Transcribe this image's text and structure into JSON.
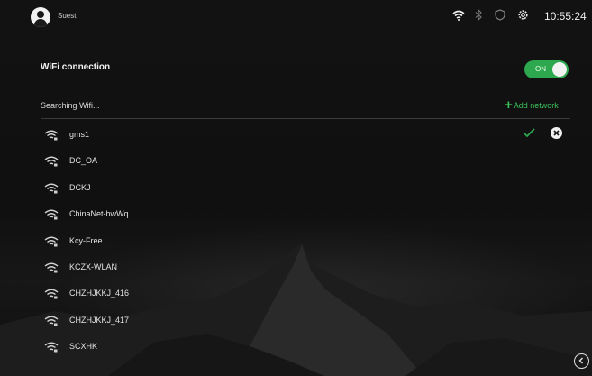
{
  "status_bar": {
    "user_name": "Suest",
    "time": "10:55:24",
    "icons": [
      "wifi-icon",
      "bluetooth-icon",
      "shield-icon",
      "settings-icon"
    ]
  },
  "wifi": {
    "title": "WiFi connection",
    "toggle_label": "ON",
    "toggle_state": "on",
    "searching_text": "Searching Wifi...",
    "add_network_label": "Add network",
    "accent_color": "#2ea84f",
    "networks": [
      {
        "name": "gms1",
        "connected": true
      },
      {
        "name": "DC_OA",
        "connected": false
      },
      {
        "name": "DCKJ",
        "connected": false
      },
      {
        "name": "ChinaNet-bwWq",
        "connected": false
      },
      {
        "name": "Kcy-Free",
        "connected": false
      },
      {
        "name": "KCZX-WLAN",
        "connected": false
      },
      {
        "name": "CHZHJKKJ_416",
        "connected": false
      },
      {
        "name": "CHZHJKKJ_417",
        "connected": false
      },
      {
        "name": "SCXHK",
        "connected": false
      }
    ]
  },
  "navigation": {
    "back_icon": "chevron-left-circle-icon"
  }
}
